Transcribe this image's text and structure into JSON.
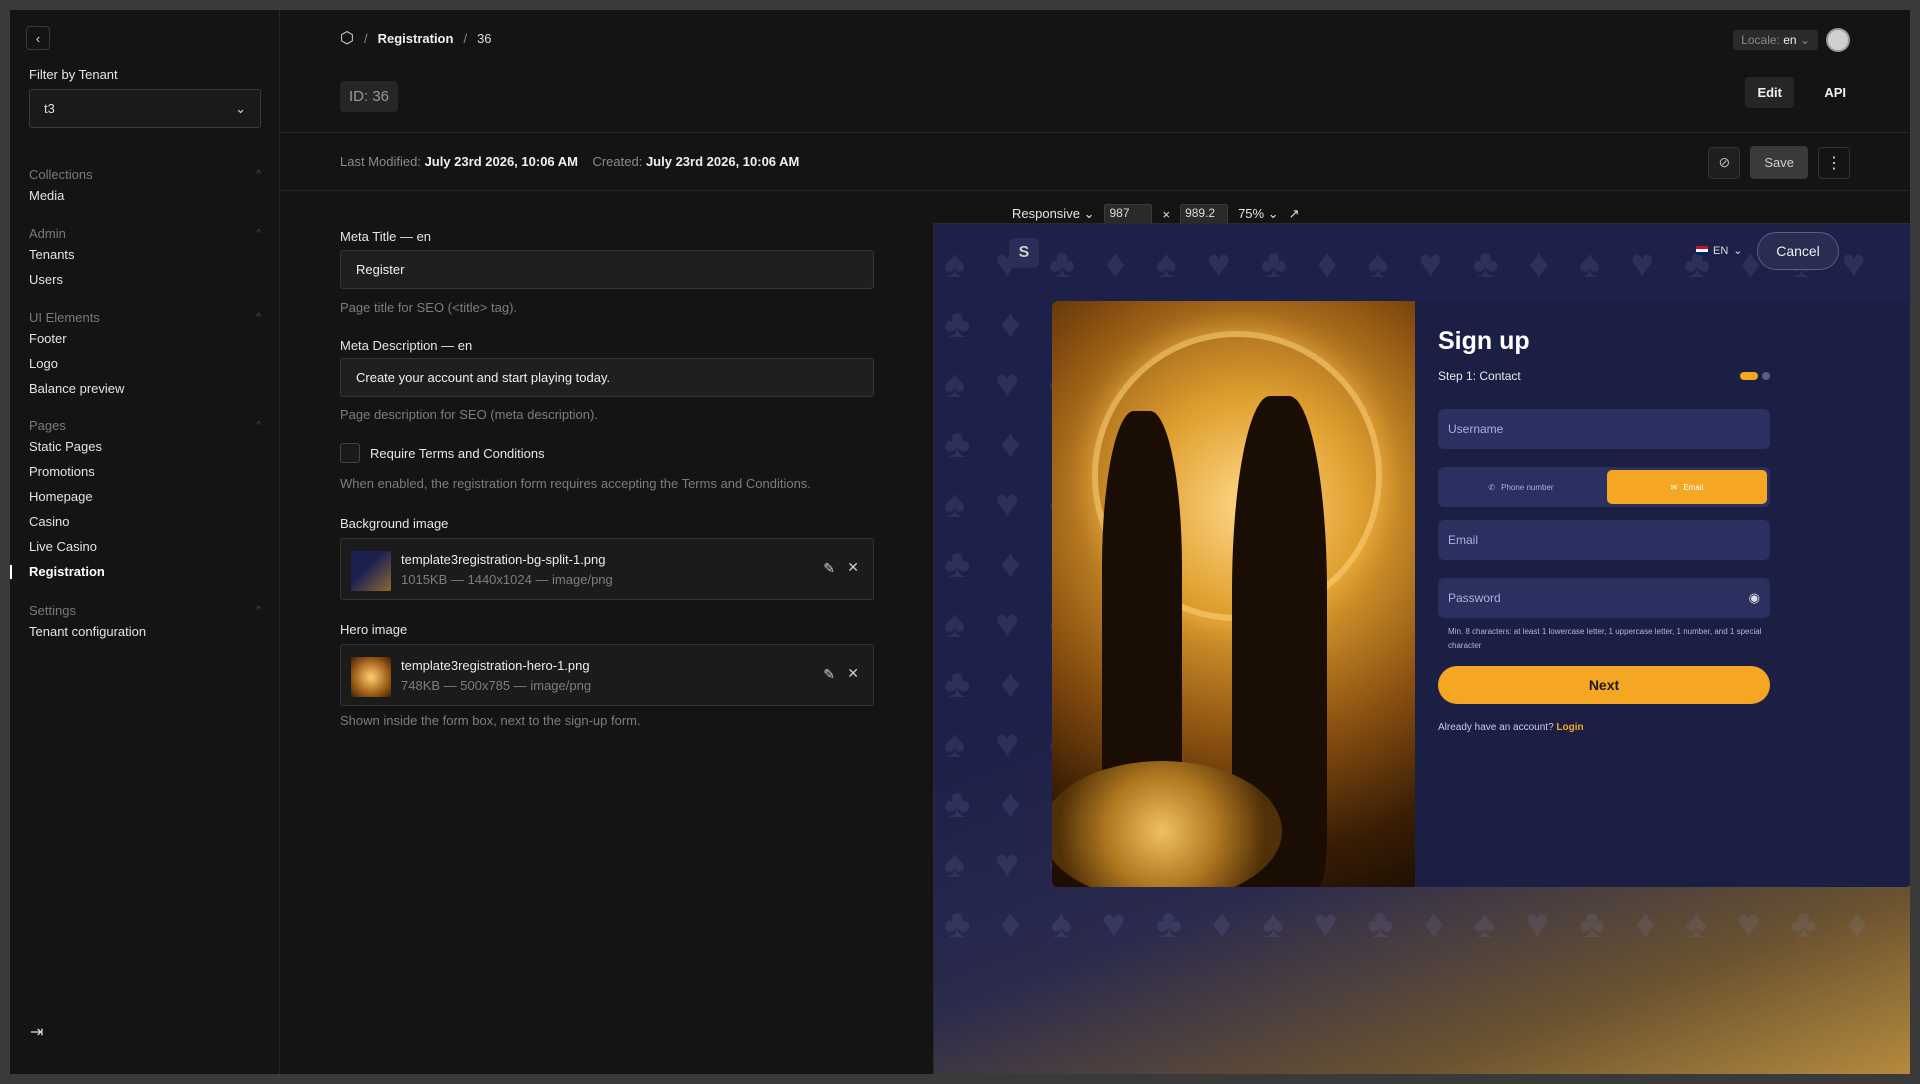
{
  "sidebar": {
    "filter_label": "Filter by Tenant",
    "tenant_value": "t3",
    "groups": [
      {
        "title": "Collections",
        "items": [
          "Media"
        ]
      },
      {
        "title": "Admin",
        "items": [
          "Tenants",
          "Users"
        ]
      },
      {
        "title": "UI Elements",
        "items": [
          "Footer",
          "Logo",
          "Balance preview"
        ]
      },
      {
        "title": "Pages",
        "items": [
          "Static Pages",
          "Promotions",
          "Homepage",
          "Casino",
          "Live Casino",
          "Registration"
        ]
      },
      {
        "title": "Settings",
        "items": [
          "Tenant configuration"
        ]
      }
    ],
    "active_item": "Registration"
  },
  "header": {
    "breadcrumb_sep": "/",
    "breadcrumb": [
      "Registration",
      "36"
    ],
    "locale_label": "Locale:",
    "locale_value": "en",
    "id_badge": "ID: 36",
    "tab_edit": "Edit",
    "tab_api": "API",
    "last_modified_label": "Last Modified:",
    "last_modified_value": "July 23rd 2026, 10:06 AM",
    "created_label": "Created:",
    "created_value": "July 23rd 2026, 10:06 AM",
    "save_label": "Save"
  },
  "form": {
    "meta_title_label": "Meta Title — en",
    "meta_title_value": "Register",
    "meta_title_hint": "Page title for SEO (<title> tag).",
    "meta_desc_label": "Meta Description — en",
    "meta_desc_value": "Create your account and start playing today.",
    "meta_desc_hint": "Page description for SEO (meta description).",
    "terms_label": "Require Terms and Conditions",
    "terms_hint": "When enabled, the registration form requires accepting the Terms and Conditions.",
    "bg_label": "Background image",
    "bg_file": "template3registration-bg-split-1.png",
    "bg_info": "1015KB — 1440x1024 — image/png",
    "hero_label": "Hero image",
    "hero_file": "template3registration-hero-1.png",
    "hero_info": "748KB — 500x785 — image/png",
    "hero_hint": "Shown inside the form box, next to the sign-up form."
  },
  "preview_toolbar": {
    "mode": "Responsive",
    "width": "987",
    "times": "×",
    "height": "989.2",
    "zoom": "75%"
  },
  "preview": {
    "lang": "EN",
    "cancel": "Cancel",
    "title": "Sign up",
    "step": "Step 1: Contact",
    "username_ph": "Username",
    "phone_opt": "Phone number",
    "email_opt": "Email",
    "email_ph": "Email",
    "password_ph": "Password",
    "pw_hint": "Min. 8 characters: at least 1 lowercase letter, 1 uppercase letter, 1 number, and 1 special character",
    "next": "Next",
    "have_account": "Already have an account?",
    "login": "Login"
  },
  "colors": {
    "accent": "#f5a623",
    "preview_bg": "#1d2048",
    "panel_bg": "#141414"
  }
}
